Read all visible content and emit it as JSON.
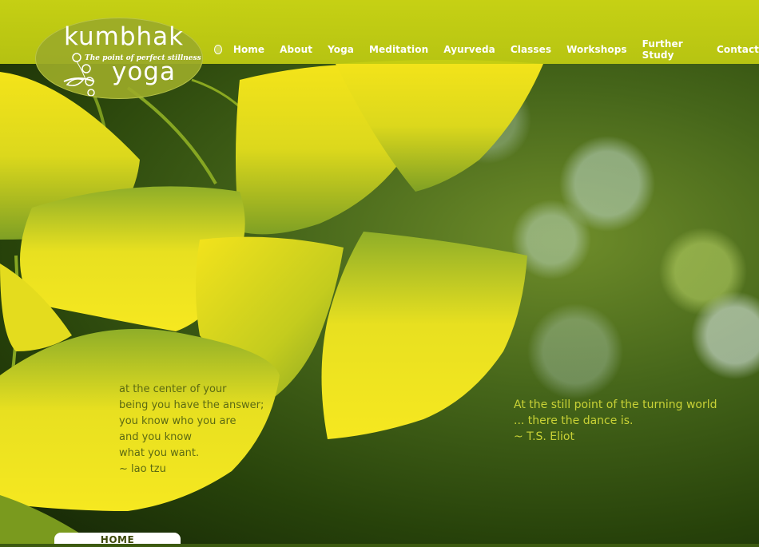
{
  "logo": {
    "word1": "kumbhak",
    "tagline": "The point of perfect stillness",
    "word2": "yoga"
  },
  "nav": {
    "items": [
      "Home",
      "About",
      "Yoga",
      "Meditation",
      "Ayurveda",
      "Classes",
      "Workshops",
      "Further Study",
      "Contact"
    ]
  },
  "quote_left": {
    "lines": [
      "at the center of your",
      "being you have the answer;",
      "you know who you are",
      "and you know",
      "what you want."
    ],
    "author": "~ lao tzu"
  },
  "quote_right": {
    "lines": [
      "At the still point of the turning world",
      "... there the dance is."
    ],
    "author": "~ T.S. Eliot"
  },
  "page_tab": "HOME",
  "colors": {
    "nav_bar": "#c9d414",
    "logo_bg": "#9baa28",
    "quote_left": "#5c6a12",
    "quote_right": "#c9d236",
    "leaf_yellow": "#f0e010",
    "leaf_green": "#8aa820"
  }
}
